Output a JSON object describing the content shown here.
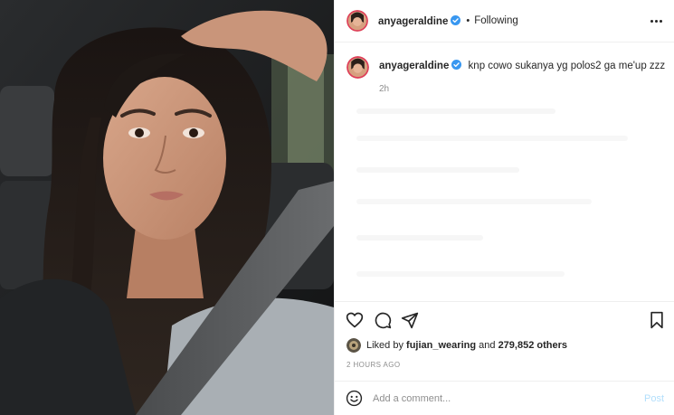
{
  "header": {
    "username": "anyageraldine",
    "separator": "•",
    "follow_status": "Following",
    "more_icon": "more-horizontal-icon"
  },
  "caption": {
    "username": "anyageraldine",
    "text": "knp cowo sukanya yg polos2 ga me'up zzz",
    "time": "2h"
  },
  "actions": {
    "icons": [
      "heart-icon",
      "comment-icon",
      "share-icon",
      "bookmark-icon"
    ]
  },
  "likes": {
    "prefix": "Liked by",
    "user": "fujian_wearing",
    "conjunction": "and",
    "count": "279,852 others"
  },
  "posted_ago": "2 HOURS AGO",
  "comment_bar": {
    "placeholder": "Add a comment...",
    "post_label": "Post",
    "emoji_icon": "smiley-icon"
  },
  "colors": {
    "verified_blue": "#3897f0",
    "post_button_disabled": "#b2dffc",
    "muted_text": "#8e8e8e",
    "divider": "#efefef"
  }
}
